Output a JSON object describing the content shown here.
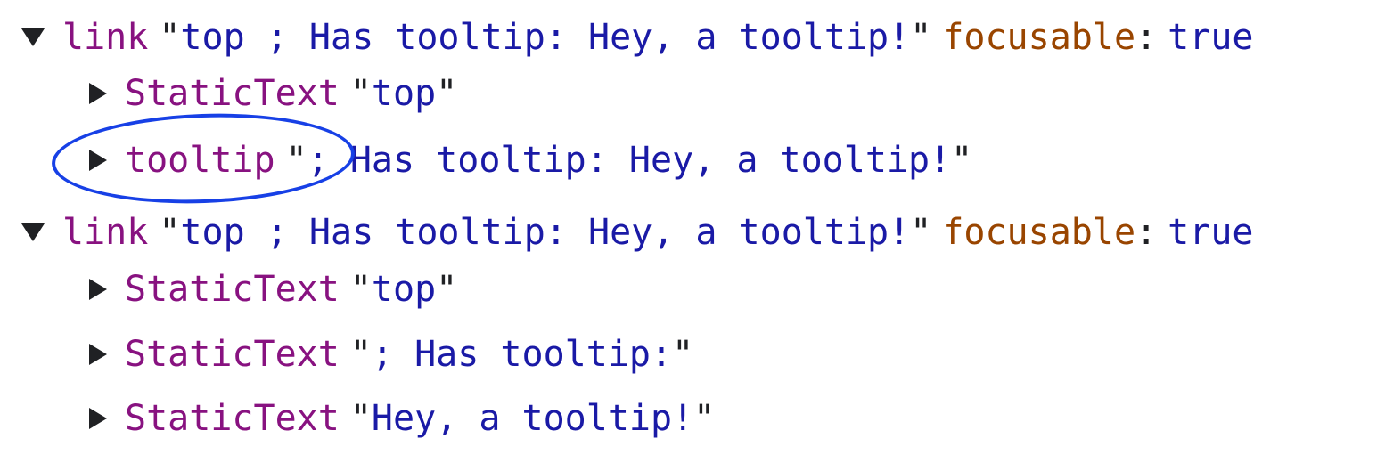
{
  "tree": {
    "nodes": [
      {
        "role": "link",
        "name": "top ; Has tooltip: Hey, a tooltip!",
        "expanded": true,
        "prop_name": "focusable",
        "prop_value": "true"
      },
      {
        "role": "StaticText",
        "name": "top",
        "expanded": false
      },
      {
        "role": "tooltip",
        "name_open": "; ",
        "trailing": "Has tooltip: Hey, a tooltip!",
        "expanded": false,
        "highlighted": true
      },
      {
        "role": "link",
        "name": "top ; Has tooltip: Hey, a tooltip!",
        "expanded": true,
        "prop_name": "focusable",
        "prop_value": "true"
      },
      {
        "role": "StaticText",
        "name": "top",
        "expanded": false
      },
      {
        "role": "StaticText",
        "name": "; Has tooltip:",
        "expanded": false
      },
      {
        "role": "StaticText",
        "name": "Hey, a tooltip!",
        "expanded": false
      }
    ],
    "quote": "\"",
    "colon": ":"
  },
  "colors": {
    "role": "#881280",
    "string": "#1a1aa6",
    "property": "#994500",
    "highlight_ellipse": "#1740e6"
  }
}
